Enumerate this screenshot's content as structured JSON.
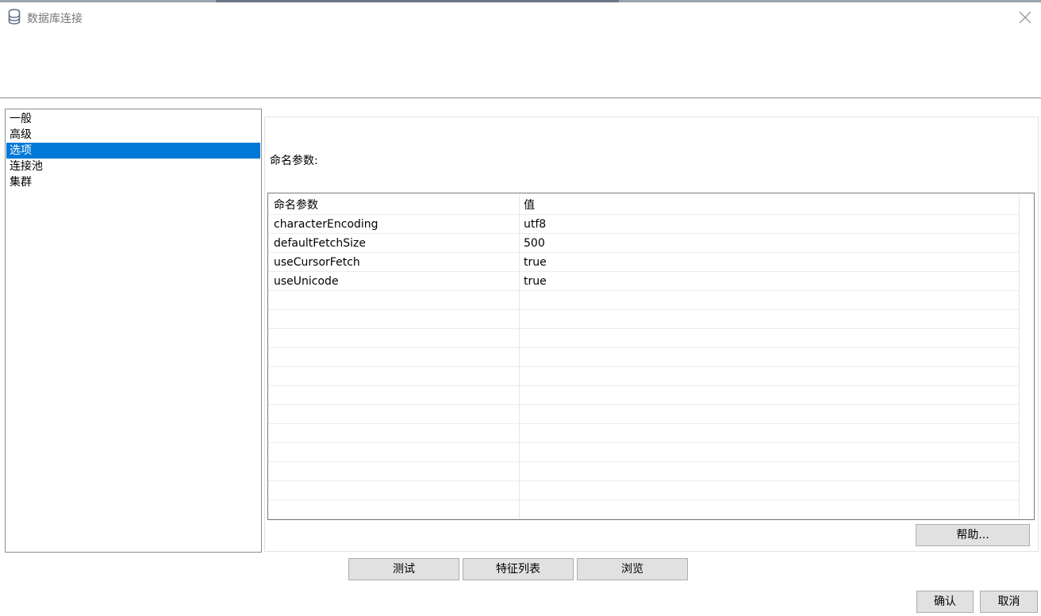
{
  "window": {
    "title": "数据库连接",
    "icon": "database-icon",
    "close_icon": "close-icon"
  },
  "nav": {
    "items": [
      {
        "label": "一般",
        "selected": false
      },
      {
        "label": "高级",
        "selected": false
      },
      {
        "label": "选项",
        "selected": true
      },
      {
        "label": "连接池",
        "selected": false
      },
      {
        "label": "集群",
        "selected": false
      }
    ]
  },
  "options": {
    "section_label": "命名参数:",
    "table": {
      "headers": [
        "命名参数",
        "值"
      ],
      "rows": [
        [
          "characterEncoding",
          "utf8"
        ],
        [
          "defaultFetchSize",
          "500"
        ],
        [
          "useCursorFetch",
          "true"
        ],
        [
          "useUnicode",
          "true"
        ]
      ],
      "empty_rows": 12
    },
    "help_label": "帮助..."
  },
  "footer": {
    "test_label": "测试",
    "feature_list_label": "特征列表",
    "browse_label": "浏览",
    "ok_label": "确认",
    "cancel_label": "取消"
  },
  "colors": {
    "selection": "#0078d7",
    "button_bg": "#e1e1e1",
    "border": "#8c8c8c"
  }
}
